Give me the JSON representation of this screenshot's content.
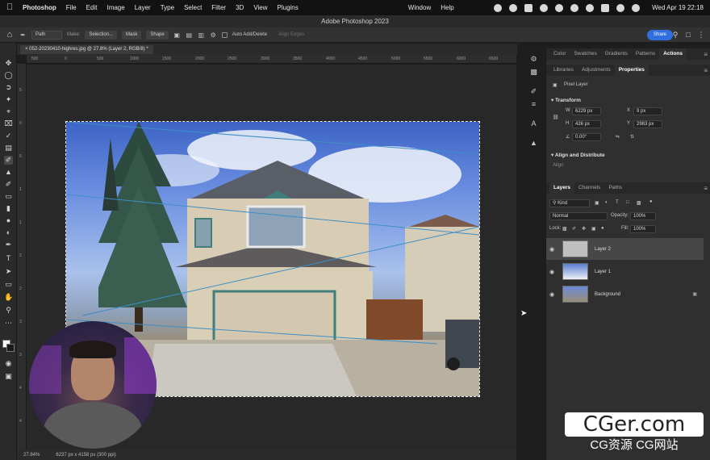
{
  "menubar": {
    "app": "Photoshop",
    "items": [
      "File",
      "Edit",
      "Image",
      "Layer",
      "Type",
      "Select",
      "Filter",
      "3D",
      "View",
      "Plugins",
      "Window",
      "Help"
    ],
    "clock": "Wed Apr 19  22:18"
  },
  "window": {
    "title": "Adobe Photoshop 2023"
  },
  "options": {
    "mode": "Path",
    "make_label": "Make:",
    "selection": "Selection...",
    "mask": "Mask",
    "shape": "Shape",
    "auto_add_delete": "Auto Add/Delete",
    "align_edges": "Align Edges",
    "share": "Share"
  },
  "document": {
    "tab": "052-20230410-highres.jpg @ 27.8% (Layer 2, RGB/8) *"
  },
  "ruler": {
    "h_ticks": [
      "500",
      "0",
      "500",
      "1000",
      "1500",
      "2000",
      "2500",
      "3000",
      "3500",
      "4000",
      "4500",
      "5000",
      "5500",
      "6000",
      "6500"
    ],
    "v_ticks": [
      "5",
      "0",
      "5",
      "1",
      "1",
      "2",
      "2",
      "3",
      "3",
      "4",
      "4"
    ]
  },
  "status": {
    "zoom": "27.84%",
    "info": "6237 px x 4158 px (300 ppi)"
  },
  "panels": {
    "top_tabs": [
      "Color",
      "Swatches",
      "Gradients",
      "Patterns",
      "Actions"
    ],
    "mid_tabs": [
      "Libraries",
      "Adjustments",
      "Properties"
    ],
    "pixel_layer": "Pixel Layer",
    "transform": "Transform",
    "w_label": "W",
    "w_value": "6229 px",
    "x_label": "X",
    "x_value": "9 px",
    "h_label": "H",
    "h_value": "426 px",
    "y_label": "Y",
    "y_value": "2983 px",
    "angle": "0.00°",
    "align_distribute": "Align and Distribute",
    "align_label": "Align:",
    "layer_tabs": [
      "Layers",
      "Channels",
      "Paths"
    ],
    "kind": "Kind",
    "blend": "Normal",
    "opacity_label": "Opacity:",
    "opacity": "100%",
    "lock_label": "Lock:",
    "fill_label": "Fill:",
    "fill": "100%",
    "layers": [
      "Layer 2",
      "Layer 1",
      "Background"
    ]
  },
  "watermark": {
    "logo": "CGer.com",
    "sub": "CG资源 CG网站"
  }
}
